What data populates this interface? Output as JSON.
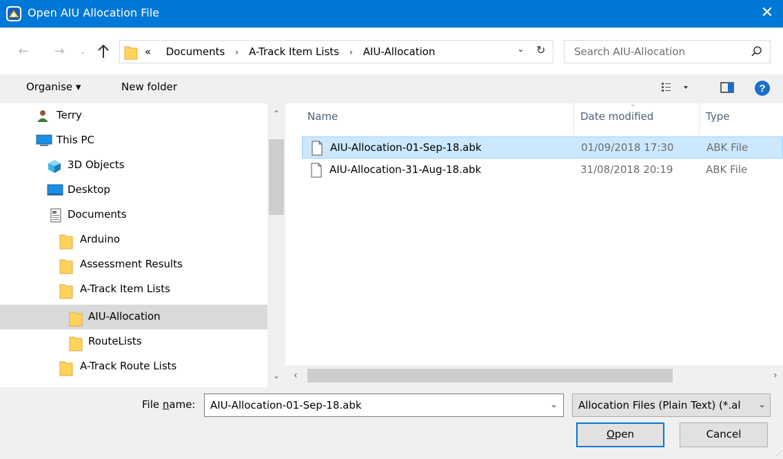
{
  "window": {
    "title": "Open AIU Allocation File",
    "close_label": "✕"
  },
  "address": {
    "overflow": "«",
    "crumbs": [
      "Documents",
      "A-Track Item Lists",
      "AIU-Allocation"
    ],
    "separator": "›"
  },
  "search": {
    "placeholder": "Search AIU-Allocation"
  },
  "toolbar": {
    "organise_label": "Organise ▾",
    "new_folder_label": "New folder"
  },
  "nav": {
    "items": [
      {
        "label": "Terry",
        "icon": "user-icon"
      },
      {
        "label": "This PC",
        "icon": "computer-icon"
      },
      {
        "label": "3D Objects",
        "icon": "3d-objects-icon"
      },
      {
        "label": "Desktop",
        "icon": "desktop-icon"
      },
      {
        "label": "Documents",
        "icon": "documents-icon"
      },
      {
        "label": "Arduino",
        "icon": "folder-icon"
      },
      {
        "label": "Assessment Results",
        "icon": "folder-icon"
      },
      {
        "label": "A-Track Item Lists",
        "icon": "folder-icon"
      },
      {
        "label": "AIU-Allocation",
        "icon": "folder-icon",
        "selected": true
      },
      {
        "label": "RouteLists",
        "icon": "folder-icon"
      },
      {
        "label": "A-Track Route Lists",
        "icon": "folder-icon"
      }
    ]
  },
  "files": {
    "columns": [
      "Name",
      "Date modified",
      "Type"
    ],
    "rows": [
      {
        "name": "AIU-Allocation-01-Sep-18.abk",
        "date": "01/09/2018 17:30",
        "type": "ABK File",
        "selected": true
      },
      {
        "name": "AIU-Allocation-31-Aug-18.abk",
        "date": "31/08/2018 20:19",
        "type": "ABK File",
        "selected": false
      }
    ]
  },
  "footer": {
    "file_name_label_pre": "File ",
    "file_name_label_u": "n",
    "file_name_label_post": "ame:",
    "file_name_value": "AIU-Allocation-01-Sep-18.abk",
    "file_type_value": "Allocation Files (Plain Text) (*.al",
    "open_u": "O",
    "open_rest": "pen",
    "cancel_label": "Cancel"
  },
  "colors": {
    "titlebar": "#0078d7",
    "selection": "#cce8ff",
    "nav_selection": "#d9d9d9",
    "folder": "#ffd35c"
  }
}
